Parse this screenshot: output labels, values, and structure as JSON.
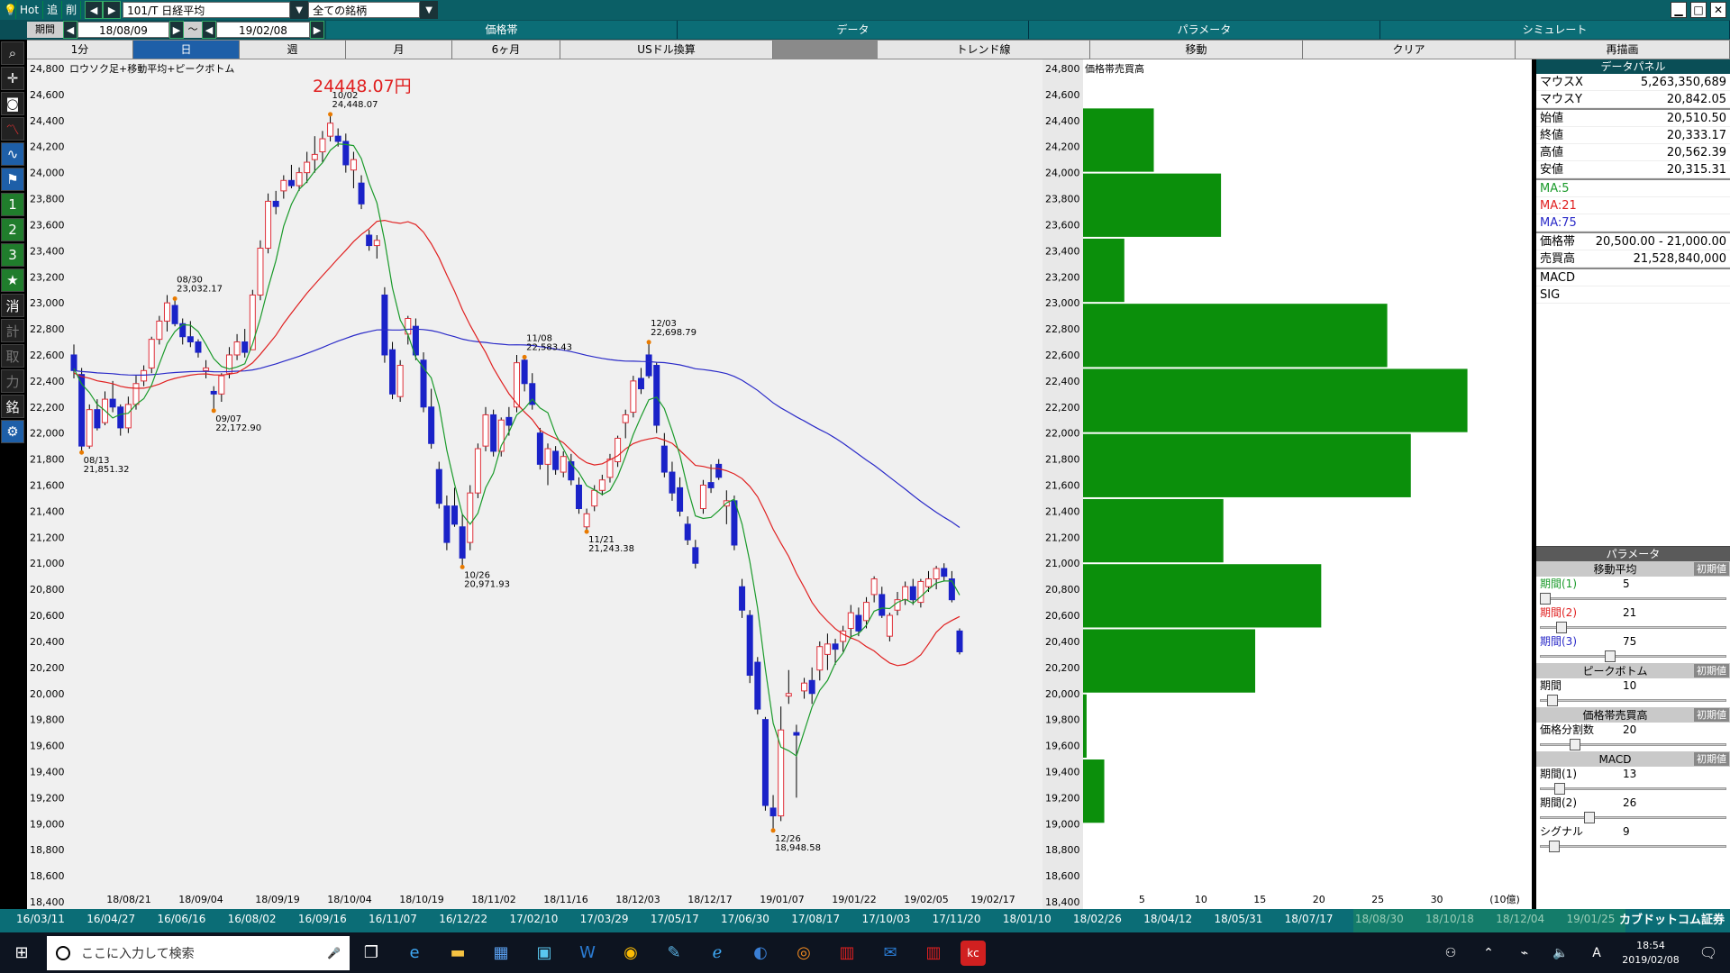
{
  "titlebar": {
    "hot": "Hot",
    "add": "追",
    "delete": "削",
    "symbol": "101/T 日経平均",
    "list": "全ての銘柄"
  },
  "toolbar2": {
    "period_label": "期間",
    "date_from": "18/08/09",
    "tilde": "～",
    "date_to": "19/02/08",
    "tabs": [
      "価格帯",
      "データ",
      "パラメータ",
      "シミュレート"
    ]
  },
  "toolbar3": {
    "tabs": [
      "1分",
      "日",
      "週",
      "月",
      "6ヶ月",
      "USドル換算",
      "トレンド線",
      "移動",
      "クリア",
      "再描画"
    ],
    "active": "日"
  },
  "left_toolbar": {
    "icons": [
      "search-icon",
      "crosshair-icon",
      "camera-icon",
      "line-chart-icon",
      "indicator-icon",
      "flag-icon",
      "1",
      "2",
      "3",
      "star-icon",
      "消",
      "計",
      "取",
      "力",
      "銘",
      "gear-icon"
    ]
  },
  "chart": {
    "title": "ロウソク足+移動平均+ピークボトム",
    "big_price": "24448.07円",
    "volume_title": "価格帯売買高",
    "volume_unit": "(10億)"
  },
  "chart_data": {
    "type": "candlestick",
    "x_dates": [
      "18/08/21",
      "18/09/04",
      "18/09/19",
      "18/10/04",
      "18/10/19",
      "18/11/02",
      "18/11/16",
      "18/12/03",
      "18/12/17",
      "19/01/07",
      "19/01/22",
      "19/02/05",
      "19/02/17"
    ],
    "y_ticks": [
      24800,
      24600,
      24400,
      24200,
      24000,
      23800,
      23600,
      23400,
      23200,
      23000,
      22800,
      22600,
      22400,
      22200,
      22000,
      21800,
      21600,
      21400,
      21200,
      21000,
      20800,
      20600,
      20400,
      20200,
      20000,
      19800,
      19600,
      19400,
      19200,
      19000,
      18800,
      18600,
      18400
    ],
    "ylim": [
      18400,
      24800
    ],
    "candles": [
      [
        22600,
        22680,
        22420,
        22480
      ],
      [
        22450,
        22500,
        21851,
        21900
      ],
      [
        21900,
        22220,
        21880,
        22180
      ],
      [
        22180,
        22260,
        22020,
        22040
      ],
      [
        22080,
        22320,
        22060,
        22260
      ],
      [
        22260,
        22400,
        22160,
        22200
      ],
      [
        22200,
        22220,
        21980,
        22040
      ],
      [
        22040,
        22280,
        22000,
        22220
      ],
      [
        22220,
        22440,
        22180,
        22380
      ],
      [
        22400,
        22520,
        22360,
        22480
      ],
      [
        22500,
        22740,
        22460,
        22720
      ],
      [
        22720,
        22900,
        22680,
        22860
      ],
      [
        22860,
        23060,
        22780,
        23000
      ],
      [
        22980,
        23032,
        22820,
        22840
      ],
      [
        22840,
        22880,
        22680,
        22740
      ],
      [
        22740,
        22860,
        22660,
        22700
      ],
      [
        22700,
        22720,
        22580,
        22620
      ],
      [
        22480,
        22560,
        22420,
        22500
      ],
      [
        22320,
        22360,
        22172,
        22300
      ],
      [
        22300,
        22460,
        22240,
        22440
      ],
      [
        22460,
        22660,
        22420,
        22600
      ],
      [
        22600,
        22760,
        22560,
        22700
      ],
      [
        22700,
        22800,
        22580,
        22620
      ],
      [
        22640,
        23100,
        22640,
        23060
      ],
      [
        23060,
        23480,
        23020,
        23420
      ],
      [
        23420,
        23840,
        23380,
        23780
      ],
      [
        23780,
        23860,
        23680,
        23740
      ],
      [
        23860,
        23980,
        23800,
        23940
      ],
      [
        23940,
        24060,
        23880,
        23900
      ],
      [
        23900,
        24040,
        23860,
        24000
      ],
      [
        24000,
        24160,
        23920,
        24080
      ],
      [
        24100,
        24280,
        24000,
        24140
      ],
      [
        24160,
        24320,
        24080,
        24260
      ],
      [
        24280,
        24448,
        24240,
        24380
      ],
      [
        24280,
        24340,
        24200,
        24240
      ],
      [
        24240,
        24300,
        24000,
        24060
      ],
      [
        24020,
        24160,
        23880,
        24100
      ],
      [
        23920,
        23980,
        23720,
        23760
      ],
      [
        23520,
        23560,
        23400,
        23440
      ],
      [
        23440,
        23520,
        23340,
        23480
      ],
      [
        23060,
        23120,
        22540,
        22600
      ],
      [
        22640,
        22700,
        22260,
        22300
      ],
      [
        22280,
        22560,
        22240,
        22520
      ],
      [
        22760,
        22900,
        22680,
        22880
      ],
      [
        22820,
        22880,
        22560,
        22600
      ],
      [
        22560,
        22620,
        22160,
        22200
      ],
      [
        22200,
        22340,
        21880,
        21920
      ],
      [
        21720,
        21780,
        21420,
        21460
      ],
      [
        21440,
        21520,
        21100,
        21160
      ],
      [
        21440,
        21580,
        21280,
        21300
      ],
      [
        21280,
        21380,
        20971,
        21040
      ],
      [
        21160,
        21600,
        21100,
        21540
      ],
      [
        21540,
        21920,
        21500,
        21880
      ],
      [
        21900,
        22200,
        21860,
        22140
      ],
      [
        22140,
        22180,
        21820,
        21860
      ],
      [
        21860,
        22120,
        21820,
        22100
      ],
      [
        22120,
        22200,
        21980,
        22060
      ],
      [
        22200,
        22600,
        22160,
        22540
      ],
      [
        22560,
        22583,
        22320,
        22380
      ],
      [
        22380,
        22460,
        22180,
        22220
      ],
      [
        22000,
        22040,
        21720,
        21760
      ],
      [
        21760,
        21920,
        21600,
        21880
      ],
      [
        21860,
        21900,
        21680,
        21720
      ],
      [
        21700,
        21860,
        21660,
        21820
      ],
      [
        21780,
        21840,
        21600,
        21640
      ],
      [
        21600,
        21660,
        21380,
        21420
      ],
      [
        21280,
        21420,
        21243,
        21380
      ],
      [
        21440,
        21600,
        21400,
        21560
      ],
      [
        21560,
        21680,
        21520,
        21640
      ],
      [
        21660,
        21840,
        21620,
        21800
      ],
      [
        21780,
        21980,
        21740,
        21960
      ],
      [
        22080,
        22180,
        21960,
        22140
      ],
      [
        22160,
        22440,
        22120,
        22400
      ],
      [
        22420,
        22500,
        22300,
        22340
      ],
      [
        22600,
        22698,
        22420,
        22440
      ],
      [
        22520,
        22540,
        22000,
        22060
      ],
      [
        21900,
        22000,
        21660,
        21700
      ],
      [
        21700,
        21780,
        21480,
        21540
      ],
      [
        21580,
        21660,
        21360,
        21400
      ],
      [
        21300,
        21360,
        21140,
        21180
      ],
      [
        21120,
        21180,
        20960,
        21000
      ],
      [
        21420,
        21640,
        21380,
        21600
      ],
      [
        21620,
        21760,
        21540,
        21580
      ],
      [
        21760,
        21800,
        21640,
        21660
      ],
      [
        21440,
        21560,
        21300,
        21480
      ],
      [
        21480,
        21520,
        21100,
        21140
      ],
      [
        20820,
        20880,
        20580,
        20640
      ],
      [
        20600,
        20640,
        20080,
        20140
      ],
      [
        20240,
        20280,
        19840,
        19880
      ],
      [
        19800,
        19820,
        19100,
        19140
      ],
      [
        19120,
        19220,
        18948,
        19060
      ],
      [
        19060,
        19900,
        19020,
        19720
      ],
      [
        19980,
        20180,
        19920,
        20000
      ],
      [
        19700,
        19760,
        19200,
        19680
      ],
      [
        20020,
        20120,
        19960,
        20080
      ],
      [
        20100,
        20200,
        19920,
        20000
      ],
      [
        20180,
        20400,
        20100,
        20360
      ],
      [
        20300,
        20460,
        20180,
        20380
      ],
      [
        20380,
        20420,
        20220,
        20340
      ],
      [
        20400,
        20520,
        20320,
        20480
      ],
      [
        20500,
        20680,
        20420,
        20620
      ],
      [
        20600,
        20660,
        20440,
        20480
      ],
      [
        20560,
        20740,
        20500,
        20700
      ],
      [
        20760,
        20900,
        20700,
        20880
      ],
      [
        20760,
        20820,
        20580,
        20600
      ],
      [
        20440,
        20620,
        20400,
        20600
      ],
      [
        20640,
        20780,
        20600,
        20720
      ],
      [
        20720,
        20860,
        20680,
        20820
      ],
      [
        20820,
        20880,
        20680,
        20720
      ],
      [
        20700,
        20880,
        20660,
        20860
      ],
      [
        20820,
        20940,
        20780,
        20880
      ],
      [
        20880,
        20980,
        20800,
        20960
      ],
      [
        20960,
        21000,
        20860,
        20900
      ],
      [
        20880,
        20940,
        20700,
        20720
      ],
      [
        20480,
        20500,
        20300,
        20320
      ]
    ],
    "ma5_label": "MA:5",
    "ma21_label": "MA:21",
    "ma75_label": "MA:75",
    "peaks": [
      {
        "date": "08/13",
        "value": "21,851.32"
      },
      {
        "date": "08/30",
        "value": "23,032.17"
      },
      {
        "date": "09/07",
        "value": "22,172.90"
      },
      {
        "date": "10/02",
        "value": "24,448.07"
      },
      {
        "date": "10/26",
        "value": "20,971.93"
      },
      {
        "date": "11/08",
        "value": "22,583.43"
      },
      {
        "date": "11/21",
        "value": "21,243.38"
      },
      {
        "date": "12/03",
        "value": "22,698.79"
      },
      {
        "date": "12/26",
        "value": "18,948.58"
      }
    ],
    "volume_profile": {
      "x_ticks": [
        "5",
        "10",
        "15",
        "20",
        "25",
        "30"
      ],
      "xlim": [
        0,
        35
      ],
      "bins": [
        {
          "low": 24000,
          "high": 24500,
          "value": 6
        },
        {
          "low": 23500,
          "high": 24000,
          "value": 11.7
        },
        {
          "low": 23000,
          "high": 23500,
          "value": 3.5
        },
        {
          "low": 22500,
          "high": 23000,
          "value": 25.8
        },
        {
          "low": 22000,
          "high": 22500,
          "value": 32.6
        },
        {
          "low": 21500,
          "high": 22000,
          "value": 27.8
        },
        {
          "low": 21000,
          "high": 21500,
          "value": 11.9
        },
        {
          "low": 20500,
          "high": 21000,
          "value": 20.2
        },
        {
          "low": 20000,
          "high": 20500,
          "value": 14.6
        },
        {
          "low": 19500,
          "high": 20000,
          "value": 0.3
        },
        {
          "low": 19000,
          "high": 19500,
          "value": 1.8
        }
      ]
    },
    "colors": {
      "up": "#e0303a",
      "down": "#1a22c8",
      "ma5": "#1a9a2a",
      "ma21": "#e02020",
      "ma75": "#2a2ac8",
      "volume": "#0b8f0b"
    }
  },
  "datapanel": {
    "header": "データパネル",
    "rows1": [
      {
        "k": "マウスX",
        "v": "5,263,350,689"
      },
      {
        "k": "マウスY",
        "v": "20,842.05"
      }
    ],
    "rows2": [
      {
        "k": "始値",
        "v": "20,510.50"
      },
      {
        "k": "終値",
        "v": "20,333.17"
      },
      {
        "k": "高値",
        "v": "20,562.39"
      },
      {
        "k": "安値",
        "v": "20,315.31"
      }
    ],
    "ma": [
      "MA:5",
      "MA:21",
      "MA:75"
    ],
    "rows3": [
      {
        "k": "価格帯",
        "v": "20,500.00 - 21,000.00"
      },
      {
        "k": "売買高",
        "v": "21,528,840,000"
      }
    ],
    "rows4": [
      "MACD",
      "SIG"
    ]
  },
  "params": {
    "header": "パラメータ",
    "reset": "初期値",
    "sections": [
      {
        "title": "移動平均",
        "rows": [
          {
            "k": "期間(1)",
            "v": "5",
            "color": "#1a9a2a",
            "pos": 0.0
          },
          {
            "k": "期間(2)",
            "v": "21",
            "color": "#e02020",
            "pos": 0.09
          },
          {
            "k": "期間(3)",
            "v": "75",
            "color": "#2a2ac8",
            "pos": 0.37
          }
        ]
      },
      {
        "title": "ピークボトム",
        "rows": [
          {
            "k": "期間",
            "v": "10",
            "color": "#000",
            "pos": 0.04
          }
        ]
      },
      {
        "title": "価格帯売買高",
        "rows": [
          {
            "k": "価格分割数",
            "v": "20",
            "color": "#000",
            "pos": 0.17
          }
        ]
      },
      {
        "title": "MACD",
        "rows": [
          {
            "k": "期間(1)",
            "v": "13",
            "color": "#000",
            "pos": 0.08
          },
          {
            "k": "期間(2)",
            "v": "26",
            "color": "#000",
            "pos": 0.25
          },
          {
            "k": "シグナル",
            "v": "9",
            "color": "#000",
            "pos": 0.05
          }
        ]
      }
    ]
  },
  "statusbar": {
    "dates": [
      "16/03/11",
      "16/04/27",
      "16/06/16",
      "16/08/02",
      "16/09/16",
      "16/11/07",
      "16/12/22",
      "17/02/10",
      "17/03/29",
      "17/05/17",
      "17/06/30",
      "17/08/17",
      "17/10/03",
      "17/11/20",
      "18/01/10",
      "18/02/26",
      "18/04/12",
      "18/05/31",
      "18/07/17",
      "18/08/30",
      "18/10/18",
      "18/12/04",
      "19/01/25"
    ],
    "brand": "カブドットコム証券"
  },
  "taskbar": {
    "search_placeholder": "ここに入力して検索",
    "time": "18:54",
    "date": "2019/02/08",
    "lang": "A"
  }
}
